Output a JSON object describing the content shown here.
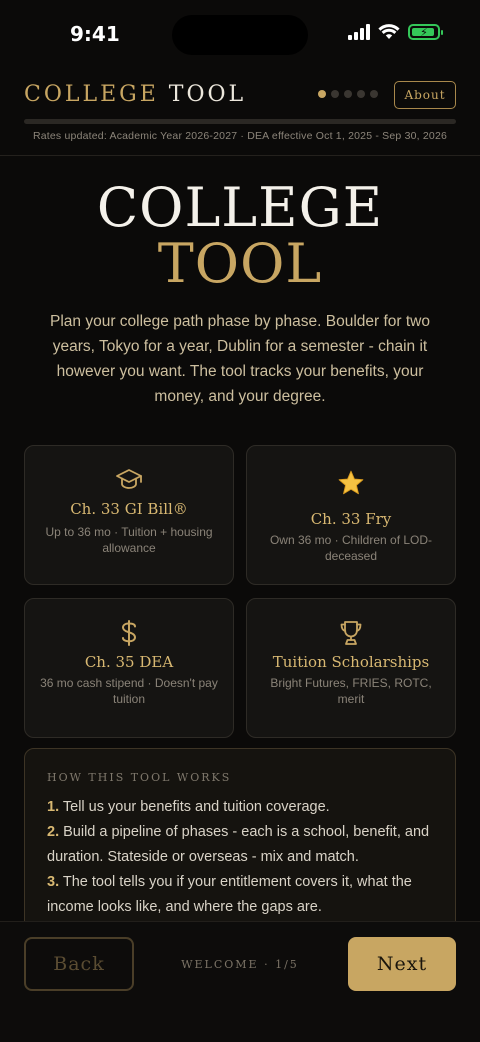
{
  "status_bar": {
    "time": "9:41",
    "icons": [
      "signal-icon",
      "wifi-icon",
      "battery-charging-icon"
    ],
    "battery_color": "#34c759"
  },
  "header": {
    "brand_part1": "COLLEGE",
    "brand_part2": "TOOL",
    "about_label": "About",
    "step_dots": {
      "total": 5,
      "active": 1
    },
    "rates_text": "Rates updated: Academic Year 2026-2027 · DEA effective Oct 1, 2025 - Sep 30, 2026"
  },
  "hero": {
    "title_line1": "COLLEGE",
    "title_line2": "TOOL",
    "description": "Plan your college path phase by phase. Boulder for two years, Tokyo for a year, Dublin for a semester - chain it however you want. The tool tracks your benefits, your money, and your degree."
  },
  "benefits": [
    {
      "icon": "graduation-cap-icon",
      "title": "Ch. 33 GI Bill®",
      "subtitle": "Up to 36 mo · Tuition + housing allowance"
    },
    {
      "icon": "star-icon",
      "title": "Ch. 33 Fry",
      "subtitle": "Own 36 mo · Children of LOD-deceased"
    },
    {
      "icon": "dollar-icon",
      "title": "Ch. 35 DEA",
      "subtitle": "36 mo cash stipend · Doesn't pay tuition"
    },
    {
      "icon": "trophy-icon",
      "title": "Tuition Scholarships",
      "subtitle": "Bright Futures, FRIES, ROTC, merit"
    }
  ],
  "how_it_works": {
    "title": "HOW THIS TOOL WORKS",
    "steps": [
      {
        "num": "1.",
        "text": "Tell us your benefits and tuition coverage."
      },
      {
        "num": "2.",
        "text": "Build a pipeline of phases - each is a school, benefit, and duration. Stateside or overseas - mix and match."
      },
      {
        "num": "3.",
        "text": "The tool tells you if your entitlement covers it, what the income looks like, and where the gaps are."
      }
    ]
  },
  "footer": {
    "back_label": "Back",
    "step_label": "WELCOME · 1/5",
    "next_label": "Next"
  },
  "colors": {
    "accent_gold": "#c8a662",
    "background": "#0b0a09",
    "card_background": "#151412"
  }
}
